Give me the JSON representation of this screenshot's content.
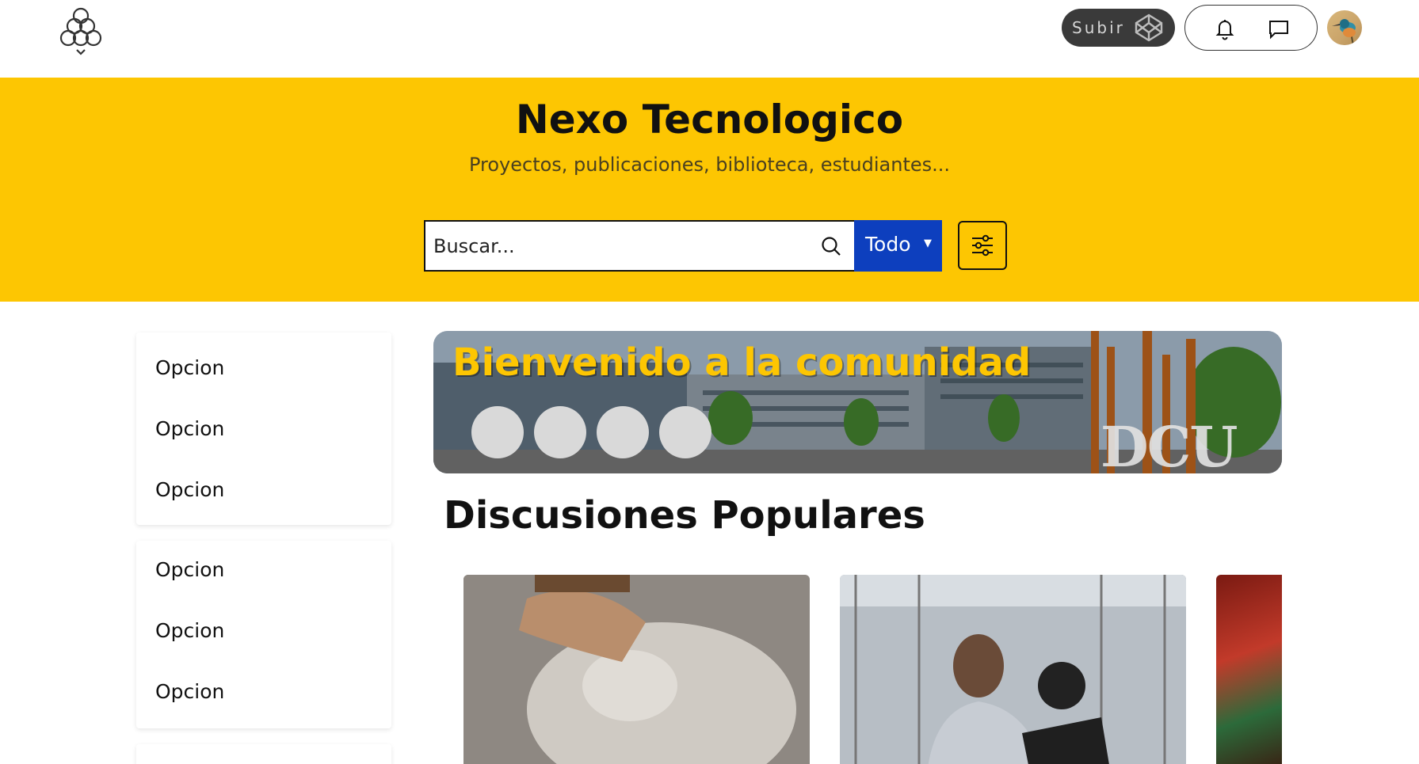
{
  "header": {
    "upload_label": "Subir",
    "icons": [
      "logo-icon",
      "codepen-icon",
      "bell-icon",
      "chat-icon"
    ],
    "avatar_alt": ""
  },
  "hero": {
    "title": "Nexo Tecnologico",
    "subtitle": "Proyectos, publicaciones, biblioteca, estudiantes...",
    "search_placeholder": "Buscar...",
    "scope_label": "Todo",
    "colors": {
      "background": "#fdc602",
      "scope": "#0d3fbe"
    }
  },
  "sidebar": {
    "groups": [
      {
        "items": [
          {
            "label": "Opcion"
          },
          {
            "label": "Opcion"
          },
          {
            "label": "Opcion"
          }
        ]
      },
      {
        "items": [
          {
            "label": "Opcion"
          },
          {
            "label": "Opcion"
          },
          {
            "label": "Opcion"
          }
        ]
      }
    ]
  },
  "banner": {
    "title": "Bienvenido a la comunidad",
    "watermark": "DCU"
  },
  "main": {
    "section_title": "Discusiones Populares"
  }
}
